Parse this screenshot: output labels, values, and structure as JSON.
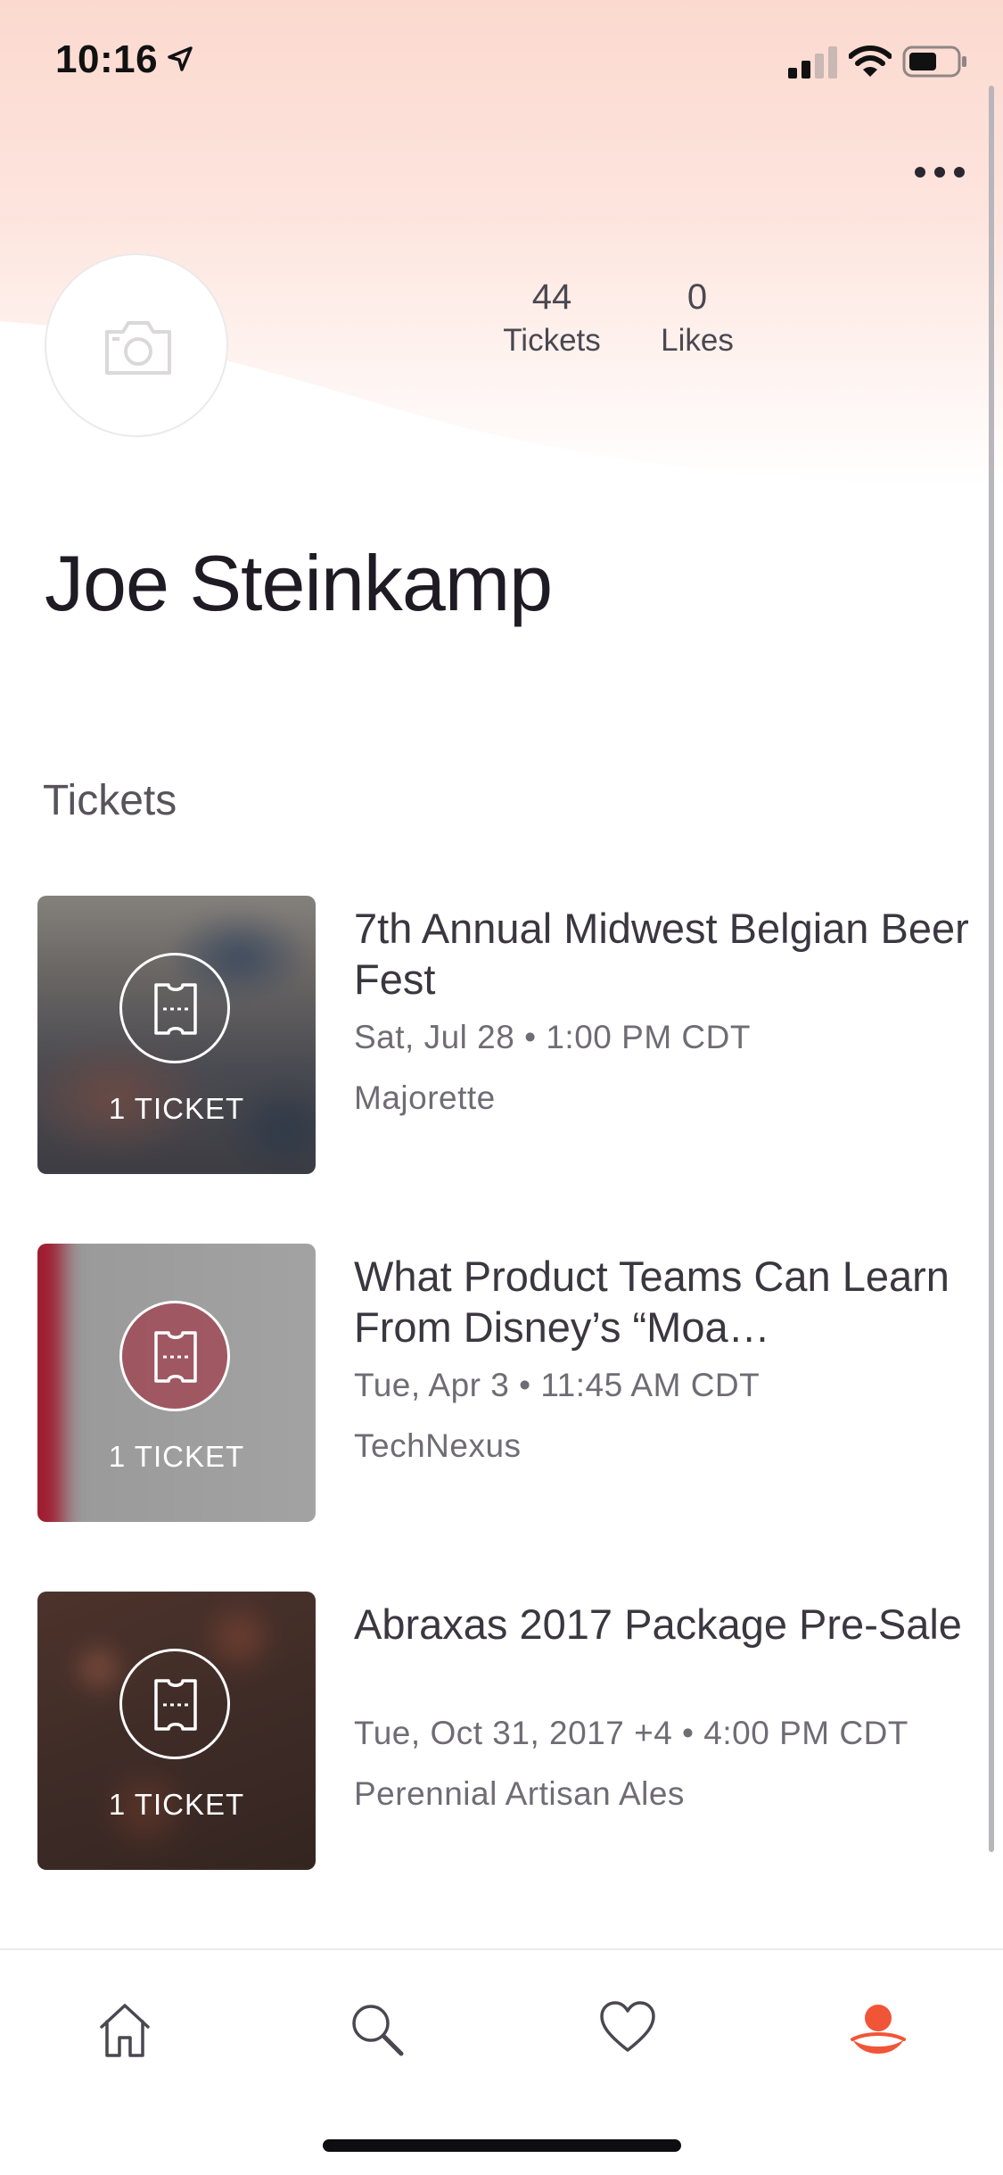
{
  "status_bar": {
    "time": "10:16",
    "icons": [
      "location-arrow-icon",
      "cellular-signal-icon",
      "wifi-icon",
      "battery-icon"
    ]
  },
  "header": {
    "more_icon": "ellipsis-icon",
    "avatar_icon": "camera-icon"
  },
  "profile": {
    "name": "Joe Steinkamp",
    "stats": [
      {
        "value": "44",
        "label": "Tickets"
      },
      {
        "value": "0",
        "label": "Likes"
      }
    ]
  },
  "tickets_section": {
    "title": "Tickets",
    "events": [
      {
        "title": "7th Annual Midwest Belgian Beer Fest",
        "date": "Sat, Jul 28 • 1:00 PM CDT",
        "venue": "Majorette",
        "ticket_count": "1 TICKET"
      },
      {
        "title": "What Product Teams Can Learn From Disney’s “Moa…",
        "date": "Tue, Apr 3 • 11:45 AM CDT",
        "venue": "TechNexus",
        "ticket_count": "1 TICKET"
      },
      {
        "title": "Abraxas 2017 Package Pre-Sale",
        "date": "Tue, Oct 31, 2017 +4 • 4:00 PM CDT",
        "venue": "Perennial Artisan Ales",
        "ticket_count": "1 TICKET"
      }
    ]
  },
  "tab_bar": {
    "tabs": [
      {
        "icon": "home-icon",
        "active": false
      },
      {
        "icon": "search-icon",
        "active": false
      },
      {
        "icon": "heart-icon",
        "active": false
      },
      {
        "icon": "profile-icon",
        "active": true
      }
    ]
  },
  "colors": {
    "accent": "#f05537",
    "hero_top": "#fbd9cf",
    "text_primary": "#1e1b24",
    "text_secondary": "#6f6c75"
  }
}
